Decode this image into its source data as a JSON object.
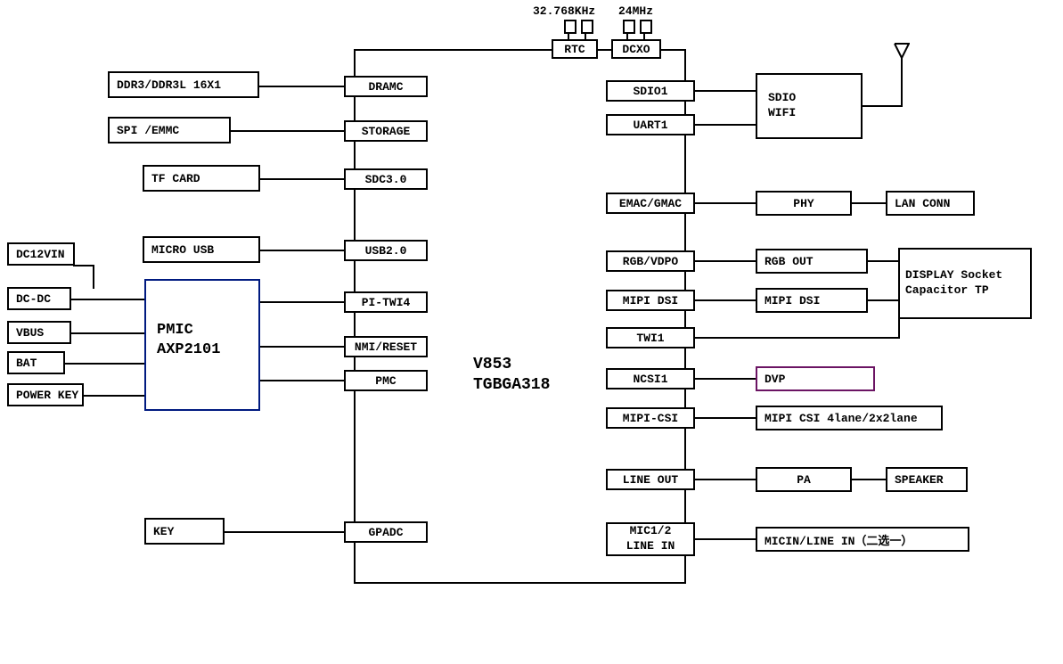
{
  "soc": {
    "line1": "V853",
    "line2": "TGBGA318"
  },
  "pmic": {
    "line1": "PMIC",
    "line2": "AXP2101"
  },
  "top": {
    "freq1": "32.768KHz",
    "freq2": "24MHz",
    "rtc": "RTC",
    "dcxo": "DCXO"
  },
  "left_ext": {
    "ddr": "DDR3/DDR3L 16X1",
    "spi_emmc": "SPI /EMMC",
    "tf": "TF CARD",
    "musb": "MICRO USB",
    "dc12": "DC12VIN",
    "dcdc": "DC-DC",
    "vbus": "VBUS",
    "bat": "BAT",
    "pkey": "POWER KEY",
    "key": "KEY"
  },
  "left_pins": {
    "dramc": "DRAMC",
    "storage": "STORAGE",
    "sdc": "SDC3.0",
    "usb20": "USB2.0",
    "pi_twi4": "PI-TWI4",
    "nmi": "NMI/RESET",
    "pmc": "PMC",
    "gpadc": "GPADC"
  },
  "right_pins": {
    "sdio1": "SDIO1",
    "uart1": "UART1",
    "emac": "EMAC/GMAC",
    "rgb": "RGB/VDPO",
    "mipi_dsi": "MIPI DSI",
    "twi1": "TWI1",
    "ncsi1": "NCSI1",
    "mipi_csi": "MIPI-CSI",
    "lineout": "LINE OUT",
    "mic": "MIC1/2\nLINE IN"
  },
  "right_ext": {
    "wifi_l1": "SDIO",
    "wifi_l2": "WIFI",
    "phy": "PHY",
    "lan": "LAN CONN",
    "rgb_out": "RGB OUT",
    "mipi_dsi2": "MIPI DSI",
    "display_l1": "DISPLAY Socket",
    "display_l2": "Capacitor TP",
    "dvp": "DVP",
    "mipi_csi_ext": "MIPI CSI 4lane/2x2lane",
    "pa": "PA",
    "speaker": "SPEAKER",
    "micin": "MICIN/LINE IN（二选一）"
  }
}
